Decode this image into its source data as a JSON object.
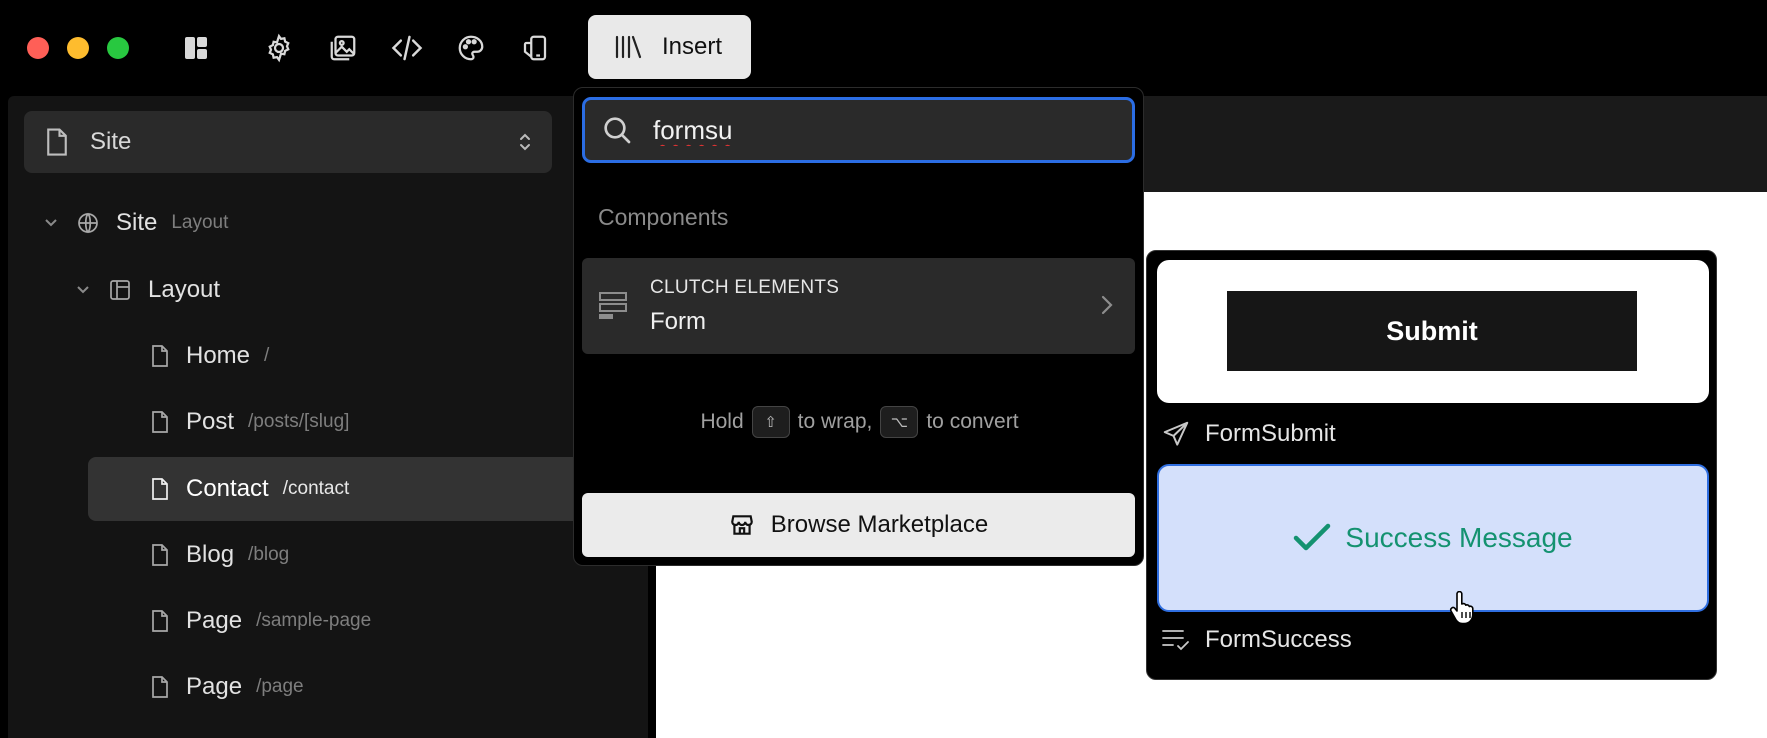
{
  "window": {
    "traffic_colors": {
      "close": "#ff5f57",
      "minimize": "#febc2e",
      "zoom": "#28c840"
    }
  },
  "toolbar": {
    "icons": [
      "layout-icon",
      "gear-icon",
      "images-icon",
      "code-icon",
      "palette-icon",
      "device-icon"
    ],
    "insert_label": "Insert"
  },
  "sidebar": {
    "site_select_label": "Site",
    "tree": [
      {
        "label": "Site",
        "sub": "Layout"
      },
      {
        "label": "Layout",
        "sub": ""
      },
      {
        "label": "Home",
        "sub": "/"
      },
      {
        "label": "Post",
        "sub": "/posts/[slug]"
      },
      {
        "label": "Contact",
        "sub": "/contact",
        "selected": true
      },
      {
        "label": "Blog",
        "sub": "/blog"
      },
      {
        "label": "Page",
        "sub": "/sample-page"
      },
      {
        "label": "Page",
        "sub": "/page"
      }
    ]
  },
  "insert_popover": {
    "search_value": "formsu",
    "section_label": "Components",
    "result": {
      "group": "CLUTCH ELEMENTS",
      "name": "Form"
    },
    "hint": {
      "hold": "Hold",
      "key1": "⇧",
      "wrap": "to wrap,",
      "key2": "⌥",
      "convert": "to convert"
    },
    "marketplace_label": "Browse Marketplace"
  },
  "preview": {
    "submit_mock_label": "Submit",
    "submit_component": "FormSubmit",
    "success_mock_label": "Success Message",
    "success_component": "FormSuccess",
    "accent_color": "#2f6ee0",
    "success_color": "#149270"
  }
}
